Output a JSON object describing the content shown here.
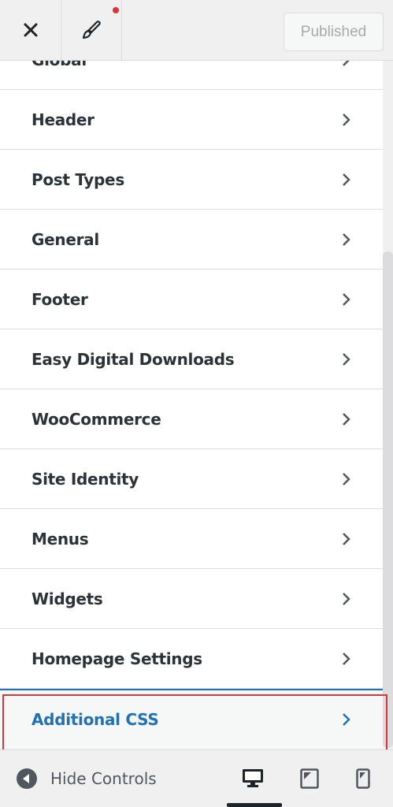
{
  "header": {
    "publish_label": "Published"
  },
  "sections": [
    {
      "label": "Global"
    },
    {
      "label": "Header"
    },
    {
      "label": "Post Types"
    },
    {
      "label": "General"
    },
    {
      "label": "Footer"
    },
    {
      "label": "Easy Digital Downloads"
    },
    {
      "label": "WooCommerce"
    },
    {
      "label": "Site Identity"
    },
    {
      "label": "Menus"
    },
    {
      "label": "Widgets"
    },
    {
      "label": "Homepage Settings"
    },
    {
      "label": "Additional CSS"
    }
  ],
  "footer": {
    "hide_controls_label": "Hide Controls"
  },
  "colors": {
    "accent": "#2271b1",
    "highlight": "#d63638",
    "notification": "#d63638"
  },
  "icons": [
    "close-icon",
    "brush-icon",
    "chevron-right-icon",
    "collapse-arrow-icon",
    "desktop-icon",
    "tablet-icon",
    "mobile-icon"
  ]
}
